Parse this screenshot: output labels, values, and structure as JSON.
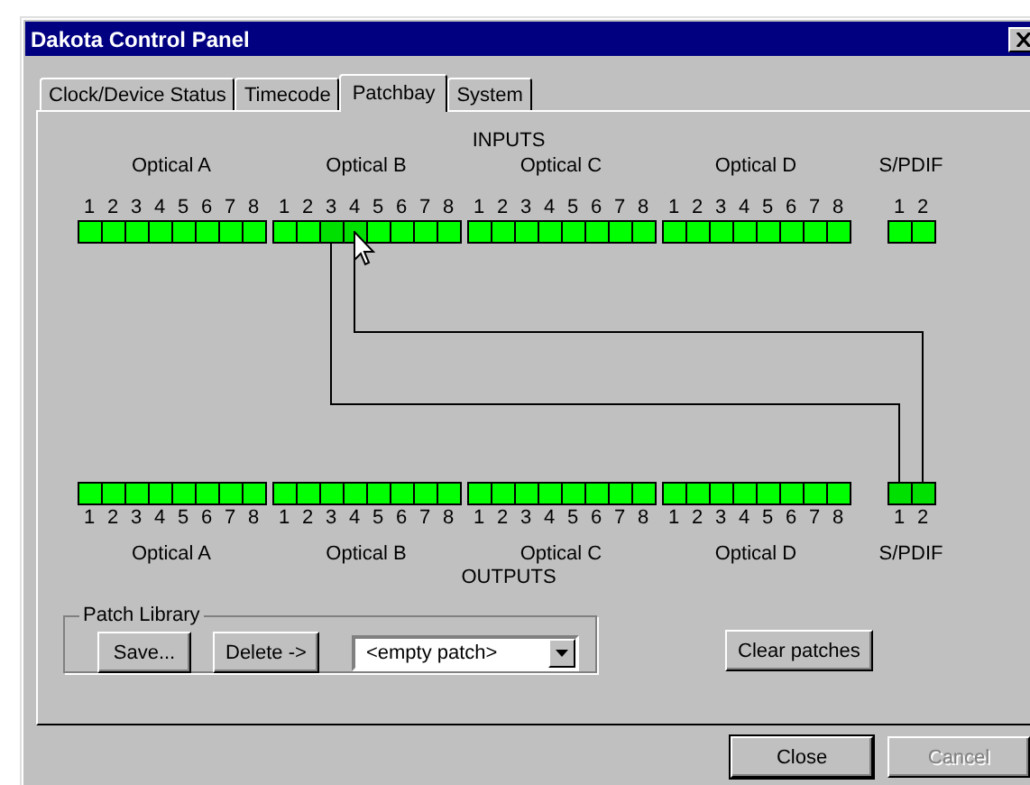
{
  "window": {
    "title": "Dakota Control Panel"
  },
  "tabs": [
    {
      "label": "Clock/Device Status",
      "selected": false
    },
    {
      "label": "Timecode",
      "selected": false
    },
    {
      "label": "Patchbay",
      "selected": true
    },
    {
      "label": "System",
      "selected": false
    }
  ],
  "inputs": {
    "heading": "INPUTS",
    "groups": [
      {
        "name": "Optical A",
        "ports": [
          {
            "label": "1",
            "patched": false
          },
          {
            "label": "2",
            "patched": false
          },
          {
            "label": "3",
            "patched": false
          },
          {
            "label": "4",
            "patched": false
          },
          {
            "label": "5",
            "patched": false
          },
          {
            "label": "6",
            "patched": false
          },
          {
            "label": "7",
            "patched": false
          },
          {
            "label": "8",
            "patched": false
          }
        ]
      },
      {
        "name": "Optical B",
        "ports": [
          {
            "label": "1",
            "patched": false
          },
          {
            "label": "2",
            "patched": false
          },
          {
            "label": "3",
            "patched": true
          },
          {
            "label": "4",
            "patched": true
          },
          {
            "label": "5",
            "patched": false
          },
          {
            "label": "6",
            "patched": false
          },
          {
            "label": "7",
            "patched": false
          },
          {
            "label": "8",
            "patched": false
          }
        ]
      },
      {
        "name": "Optical C",
        "ports": [
          {
            "label": "1",
            "patched": false
          },
          {
            "label": "2",
            "patched": false
          },
          {
            "label": "3",
            "patched": false
          },
          {
            "label": "4",
            "patched": false
          },
          {
            "label": "5",
            "patched": false
          },
          {
            "label": "6",
            "patched": false
          },
          {
            "label": "7",
            "patched": false
          },
          {
            "label": "8",
            "patched": false
          }
        ]
      },
      {
        "name": "Optical D",
        "ports": [
          {
            "label": "1",
            "patched": false
          },
          {
            "label": "2",
            "patched": false
          },
          {
            "label": "3",
            "patched": false
          },
          {
            "label": "4",
            "patched": false
          },
          {
            "label": "5",
            "patched": false
          },
          {
            "label": "6",
            "patched": false
          },
          {
            "label": "7",
            "patched": false
          },
          {
            "label": "8",
            "patched": false
          }
        ]
      },
      {
        "name": "S/PDIF",
        "ports": [
          {
            "label": "1",
            "patched": false
          },
          {
            "label": "2",
            "patched": false
          }
        ]
      }
    ]
  },
  "outputs": {
    "heading": "OUTPUTS",
    "groups": [
      {
        "name": "Optical A",
        "ports": [
          {
            "label": "1",
            "patched": false
          },
          {
            "label": "2",
            "patched": false
          },
          {
            "label": "3",
            "patched": false
          },
          {
            "label": "4",
            "patched": false
          },
          {
            "label": "5",
            "patched": false
          },
          {
            "label": "6",
            "patched": false
          },
          {
            "label": "7",
            "patched": false
          },
          {
            "label": "8",
            "patched": false
          }
        ]
      },
      {
        "name": "Optical B",
        "ports": [
          {
            "label": "1",
            "patched": false
          },
          {
            "label": "2",
            "patched": false
          },
          {
            "label": "3",
            "patched": false
          },
          {
            "label": "4",
            "patched": false
          },
          {
            "label": "5",
            "patched": false
          },
          {
            "label": "6",
            "patched": false
          },
          {
            "label": "7",
            "patched": false
          },
          {
            "label": "8",
            "patched": false
          }
        ]
      },
      {
        "name": "Optical C",
        "ports": [
          {
            "label": "1",
            "patched": false
          },
          {
            "label": "2",
            "patched": false
          },
          {
            "label": "3",
            "patched": false
          },
          {
            "label": "4",
            "patched": false
          },
          {
            "label": "5",
            "patched": false
          },
          {
            "label": "6",
            "patched": false
          },
          {
            "label": "7",
            "patched": false
          },
          {
            "label": "8",
            "patched": false
          }
        ]
      },
      {
        "name": "Optical D",
        "ports": [
          {
            "label": "1",
            "patched": false
          },
          {
            "label": "2",
            "patched": false
          },
          {
            "label": "3",
            "patched": false
          },
          {
            "label": "4",
            "patched": false
          },
          {
            "label": "5",
            "patched": false
          },
          {
            "label": "6",
            "patched": false
          },
          {
            "label": "7",
            "patched": false
          },
          {
            "label": "8",
            "patched": false
          }
        ]
      },
      {
        "name": "S/PDIF",
        "ports": [
          {
            "label": "1",
            "patched": true
          },
          {
            "label": "2",
            "patched": true
          }
        ]
      }
    ]
  },
  "patch_library": {
    "label": "Patch Library",
    "buttons": [
      "Save...",
      "Delete ->"
    ],
    "dropdown_value": "<empty patch>"
  },
  "clear_button": "Clear patches",
  "dialog_buttons": [
    {
      "label": "Close",
      "disabled": false
    },
    {
      "label": "Cancel",
      "disabled": true
    }
  ]
}
